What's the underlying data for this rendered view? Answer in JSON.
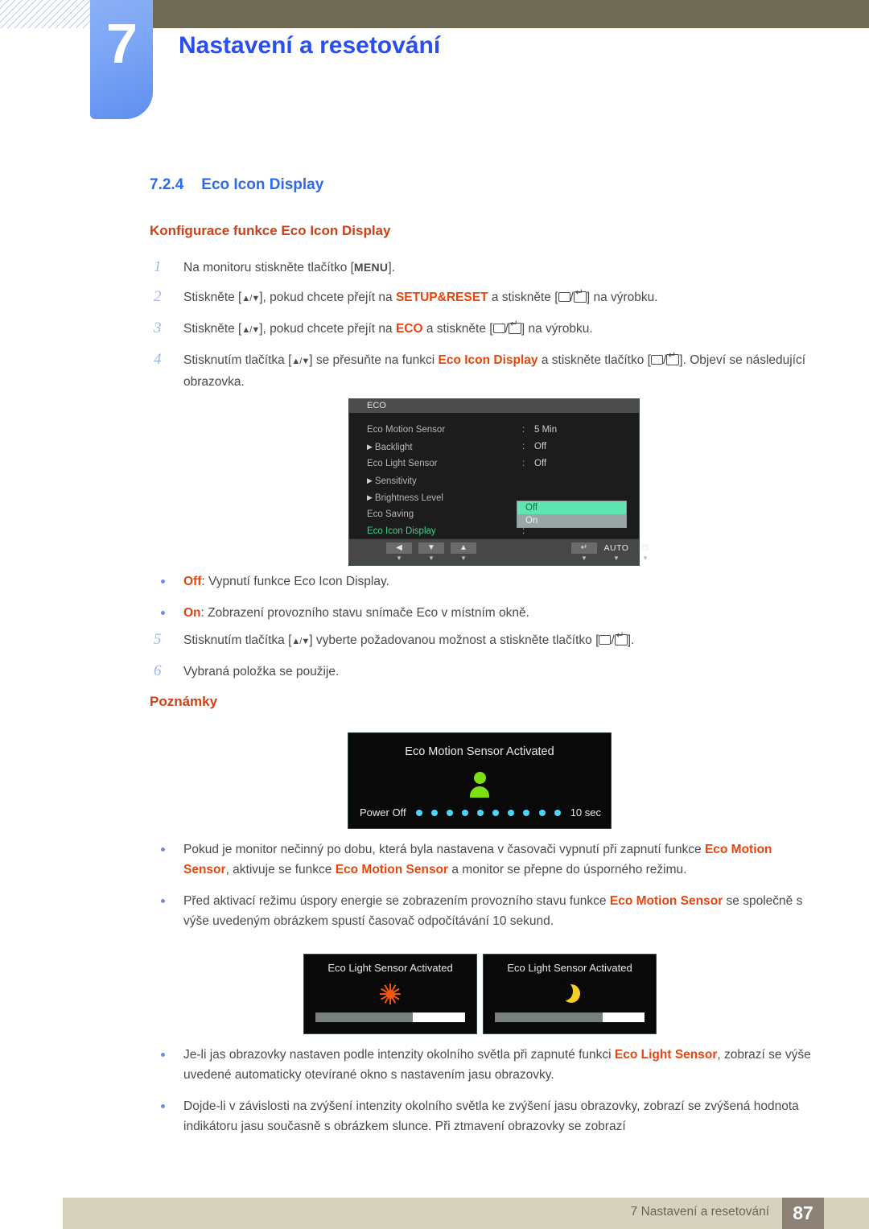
{
  "header": {
    "chapter_number": "7",
    "chapter_title": "Nastavení a resetování"
  },
  "section": {
    "number": "7.2.4",
    "title": "Eco Icon Display",
    "sub_heading": "Konfigurace funkce Eco Icon Display"
  },
  "steps": [
    {
      "index": "1",
      "html": "Na monitoru stiskněte tlačítko [<span class=\"btn-lbl\">MENU</span>]."
    },
    {
      "index": "2",
      "html": "Stiskněte [<span class=\"tri\">▲/▼</span>], pokud chcete přejít na <span class=\"kw\">SETUP&amp;RESET</span> a stiskněte [<span class=\"kbox\"></span>/<span class=\"kenter\"></span>] na výrobku."
    },
    {
      "index": "3",
      "html": "Stiskněte [<span class=\"tri\">▲/▼</span>], pokud chcete přejít na <span class=\"kw\">ECO</span> a stiskněte [<span class=\"kbox\"></span>/<span class=\"kenter\"></span>] na výrobku."
    },
    {
      "index": "4",
      "html": "Stisknutím tlačítka [<span class=\"tri\">▲/▼</span>] se přesuňte na funkci <span class=\"kw\">Eco Icon Display</span> a stiskněte tlačítko [<span class=\"kbox\"></span>/<span class=\"kenter\"></span>]. Objeví se následující obrazovka."
    }
  ],
  "osd": {
    "title": "ECO",
    "rows": [
      {
        "label": "Eco Motion Sensor",
        "arrow": false,
        "colon": ":",
        "value": "5 Min",
        "green": false
      },
      {
        "label": "Backlight",
        "arrow": true,
        "colon": ":",
        "value": "Off",
        "green": false
      },
      {
        "label": "Eco Light Sensor",
        "arrow": false,
        "colon": ":",
        "value": "Off",
        "green": false
      },
      {
        "label": "Sensitivity",
        "arrow": true,
        "colon": "",
        "value": "",
        "green": false
      },
      {
        "label": "Brightness Level",
        "arrow": true,
        "colon": "",
        "value": "",
        "green": false
      },
      {
        "label": "Eco Saving",
        "arrow": false,
        "colon": "",
        "value": "",
        "green": false
      },
      {
        "label": "Eco Icon Display",
        "arrow": false,
        "colon": ":",
        "value": "",
        "green": true
      }
    ],
    "dropdown": {
      "selected_option": "Off",
      "other_option": "On"
    },
    "footer_buttons": [
      {
        "glyph": "◀",
        "sub": "▼"
      },
      {
        "glyph": "▼",
        "sub": "▼"
      },
      {
        "glyph": "▲",
        "sub": "▼"
      },
      {
        "glyph": "↵",
        "sub": "▼"
      },
      {
        "glyph": "AUTO",
        "sub": "▼"
      },
      {
        "glyph": "⏻",
        "sub": "▼"
      }
    ]
  },
  "option_bullets": [
    {
      "html": "<span class=\"kw\">Off</span>: Vypnutí funkce Eco Icon Display."
    },
    {
      "html": "<span class=\"kw\">On</span>: Zobrazení provozního stavu snímače Eco v místním okně."
    }
  ],
  "steps_after": [
    {
      "index": "5",
      "html": "Stisknutím tlačítka [<span class=\"tri\">▲/▼</span>] vyberte požadovanou možnost a stiskněte tlačítko [<span class=\"kbox\"></span>/<span class=\"kenter\"></span>]."
    },
    {
      "index": "6",
      "html": "Vybraná položka se použije."
    }
  ],
  "notes_heading": "Poznámky",
  "motion_popup": {
    "title": "Eco Motion Sensor Activated",
    "power_label": "Power Off",
    "time_label": "10 sec",
    "dot_count": 10,
    "icon": "person-icon"
  },
  "notes_bullets": [
    {
      "html": "Pokud je monitor nečinný po dobu, která byla nastavena v časovači vypnutí při zapnutí funkce <span class=\"kw\">Eco Motion Sensor</span>, aktivuje se funkce <span class=\"kw\">Eco Motion Sensor</span> a monitor se přepne do úsporného režimu."
    },
    {
      "html": "Před aktivací režimu úspory energie se zobrazením provozního stavu funkce <span class=\"kw\">Eco Motion Sensor</span> se společně s výše uvedeným obrázkem spustí časovač odpočítávání 10 sekund."
    }
  ],
  "light_popups": [
    {
      "title": "Eco Light Sensor Activated",
      "icon": "sun-icon",
      "bar_fill_percent": 65
    },
    {
      "title": "Eco Light Sensor Activated",
      "icon": "moon-icon",
      "bar_fill_percent": 72
    }
  ],
  "bottom_bullets": [
    {
      "html": "Je-li jas obrazovky nastaven podle intenzity okolního světla při zapnuté funkci <span class=\"kw\">Eco Light Sensor</span>, zobrazí se výše uvedené automaticky otevírané okno s nastavením jasu obrazovky."
    },
    {
      "html": "Dojde-li v závislosti na zvýšení intenzity okolního světla ke zvýšení jasu obrazovky, zobrazí se zvýšená hodnota indikátoru jasu současně s obrázkem slunce. Při ztmavení obrazovky se zobrazí"
    }
  ],
  "footer": {
    "text": "7 Nastavení a resetování",
    "page_number": "87"
  },
  "colors": {
    "accent_blue": "#2b4ef0",
    "heading_blue": "#2f6ae8",
    "keyword_orange": "#e8450c",
    "sub_heading_orange": "#cc4116",
    "olive_bar": "#6f6a53",
    "footer_bar": "#d6d2bd",
    "page_box": "#8d8175",
    "osd_green": "#45d18a",
    "dropdown_selected": "#5fe6b0",
    "person_green": "#7ee014",
    "dot_cyan": "#49d6f7",
    "sun_orange": "#f05a10",
    "moon_yellow": "#f5cb2a"
  }
}
